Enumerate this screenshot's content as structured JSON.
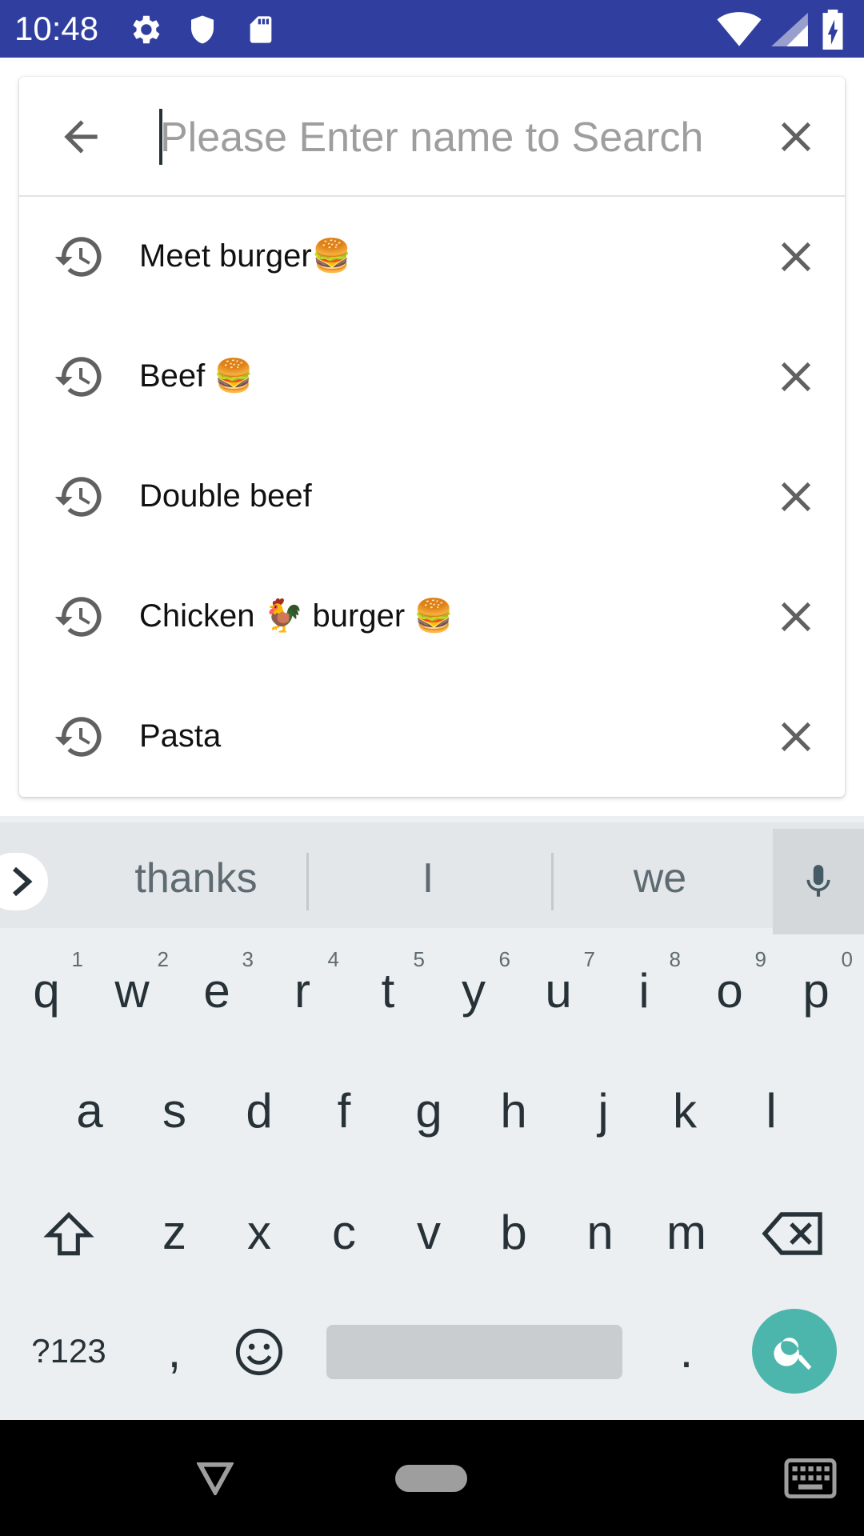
{
  "status_bar": {
    "time": "10:48",
    "icons": [
      "gear-icon",
      "shield-icon",
      "sd-card-icon",
      "wifi-icon",
      "cell-signal-icon",
      "battery-charging-icon"
    ],
    "background": "#303F9F"
  },
  "search": {
    "placeholder": "Please Enter name to Search",
    "value": "",
    "back_icon": "arrow-back-icon",
    "clear_icon": "close-icon"
  },
  "history": {
    "items": [
      {
        "label": "Meet  burger🍔"
      },
      {
        "label": "Beef 🍔"
      },
      {
        "label": "Double beef"
      },
      {
        "label": "Chicken 🐓 burger 🍔"
      },
      {
        "label": "Pasta"
      }
    ]
  },
  "keyboard": {
    "suggestions": [
      "thanks",
      "I",
      "we"
    ],
    "row1": [
      {
        "key": "q",
        "hint": "1"
      },
      {
        "key": "w",
        "hint": "2"
      },
      {
        "key": "e",
        "hint": "3"
      },
      {
        "key": "r",
        "hint": "4"
      },
      {
        "key": "t",
        "hint": "5"
      },
      {
        "key": "y",
        "hint": "6"
      },
      {
        "key": "u",
        "hint": "7"
      },
      {
        "key": "i",
        "hint": "8"
      },
      {
        "key": "o",
        "hint": "9"
      },
      {
        "key": "p",
        "hint": "0"
      }
    ],
    "row2": [
      "a",
      "s",
      "d",
      "f",
      "g",
      "h",
      "j",
      "k",
      "l"
    ],
    "row3": [
      "z",
      "x",
      "c",
      "v",
      "b",
      "n",
      "m"
    ],
    "symbols_label": "?123",
    "comma": ",",
    "period": ".",
    "accent": "#4DB6AC"
  },
  "nav_bar": {
    "icons": [
      "back-triangle-icon",
      "home-pill-icon",
      "keyboard-icon"
    ]
  }
}
